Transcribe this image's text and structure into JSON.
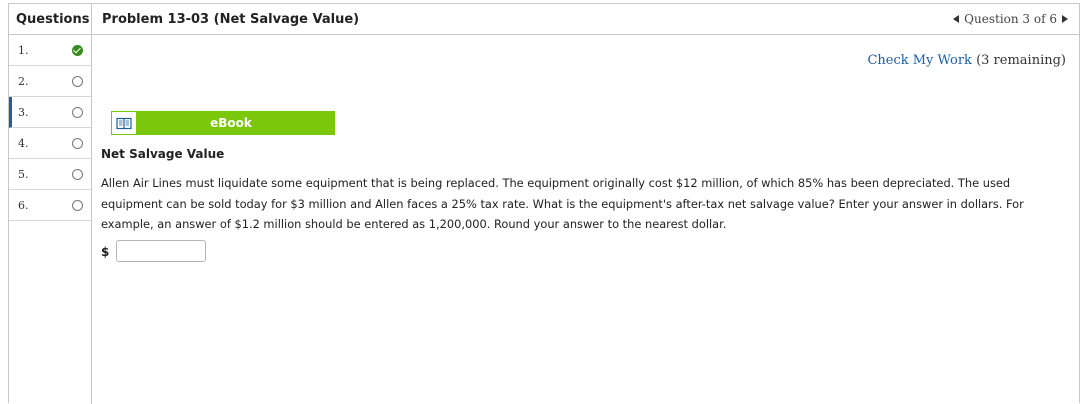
{
  "sidebar": {
    "header": "Questions",
    "items": [
      {
        "label": "1.",
        "status": "completed"
      },
      {
        "label": "2.",
        "status": "unanswered"
      },
      {
        "label": "3.",
        "status": "unanswered",
        "current": true
      },
      {
        "label": "4.",
        "status": "unanswered"
      },
      {
        "label": "5.",
        "status": "unanswered"
      },
      {
        "label": "6.",
        "status": "unanswered"
      }
    ]
  },
  "header": {
    "title": "Problem 13-03 (Net Salvage Value)",
    "question_position": "Question 3 of 6"
  },
  "check_work": {
    "link_label": "Check My Work",
    "remaining": "(3 remaining)"
  },
  "ebook": {
    "label": "eBook",
    "icon": "book-icon"
  },
  "problem": {
    "section_title": "Net Salvage Value",
    "text": "Allen Air Lines must liquidate some equipment that is being replaced. The equipment originally cost $12 million, of which 85% has been depreciated. The used equipment can be sold today for $3 million and Allen faces a 25% tax rate. What is the equipment's after-tax net salvage value? Enter your answer in dollars. For example, an answer of $1.2 million should be entered as 1,200,000. Round your answer to the nearest dollar.",
    "currency_symbol": "$",
    "answer_value": "",
    "answer_placeholder": ""
  },
  "colors": {
    "accent_green": "#7ac70c",
    "link_blue": "#1a5fa8",
    "completed_green": "#3a8a22",
    "current_marker": "#1f5f9c"
  }
}
